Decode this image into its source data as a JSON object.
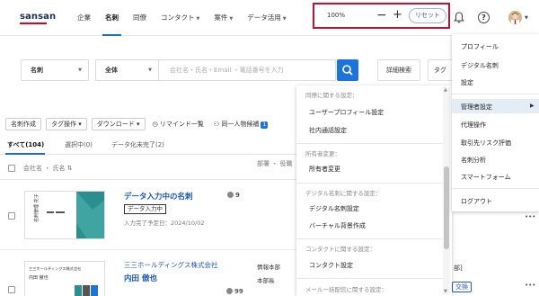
{
  "brand": {
    "logo_text": "sansan"
  },
  "nav": {
    "items": [
      {
        "label": "企業",
        "active": false,
        "dropdown": false
      },
      {
        "label": "名刺",
        "active": true,
        "dropdown": false
      },
      {
        "label": "同僚",
        "active": false,
        "dropdown": false
      },
      {
        "label": "コンタクト",
        "active": false,
        "dropdown": true
      },
      {
        "label": "案件",
        "active": false,
        "dropdown": true
      },
      {
        "label": "データ活用",
        "active": false,
        "dropdown": true
      }
    ]
  },
  "zoom": {
    "level": "100%",
    "minus": "−",
    "plus": "+",
    "reset_label": "リセット"
  },
  "header_icons": {
    "bell": "bell-icon",
    "help": "?",
    "avatar": "user-avatar"
  },
  "search": {
    "scope": "名刺",
    "filter": "全体",
    "placeholder": "会社名・氏名・Email ・電話番号を入力",
    "advanced_label": "詳細検索",
    "tag_label": "タグ"
  },
  "toolbar": {
    "create_label": "名刺作成",
    "tag_ops_label": "タグ操作",
    "download_label": "ダウンロード",
    "reminder_label": "リマインド一覧",
    "same_person_label": "同一人物候補",
    "same_person_count": "1"
  },
  "tabs": [
    {
      "label": "すべて(104)",
      "active": true
    },
    {
      "label": "選択中(0)",
      "active": false
    },
    {
      "label": "データ化未完了(2)",
      "active": false
    }
  ],
  "table": {
    "col_name": "会社名 ・ 氏名",
    "col_dept": "部署 ・ 役職"
  },
  "rows": [
    {
      "name": "データ入力中の名刺",
      "status": "データ入力中",
      "sub": "入力完了予定日：2024/10/02",
      "count": "9",
      "card_text": "名刺管理 花子"
    },
    {
      "company": "三三ホールディングス株式会社",
      "name": "内田 傲也",
      "dept": "情報本部",
      "title": "本部長",
      "count": "99",
      "card_company": "三三ホールディングス株式会社",
      "card_name": "内田 傲也"
    }
  ],
  "admin_submenu": {
    "sections": [
      {
        "heading": "同僚に関する設定：",
        "items": [
          "ユーザープロフィール設定",
          "社内通話設定"
        ]
      },
      {
        "heading": "所有者変更：",
        "items": [
          "所有者変更"
        ]
      },
      {
        "heading": "デジタル名刺に関する設定：",
        "items": [
          "デジタル名刺設定",
          "バーチャル背景作成"
        ]
      },
      {
        "heading": "コンタクトに関する設定：",
        "items": [
          "コンタクト設定"
        ]
      },
      {
        "heading": "メール一括配信に関する設定：",
        "items": []
      }
    ]
  },
  "user_menu": {
    "items": [
      "プロフィール",
      "デジタル名刺",
      "設定",
      "管理者設定",
      "代理操作",
      "取引先リスク評価",
      "名刺分析",
      "スマートフォーム",
      "ログアウト"
    ]
  },
  "right_partial": {
    "dept_frag": "部]",
    "exchange": "交換",
    "more": "•••"
  },
  "colors": {
    "accent": "#1e73d8",
    "highlight_border": "#c8102e",
    "link": "#1a56b8"
  }
}
